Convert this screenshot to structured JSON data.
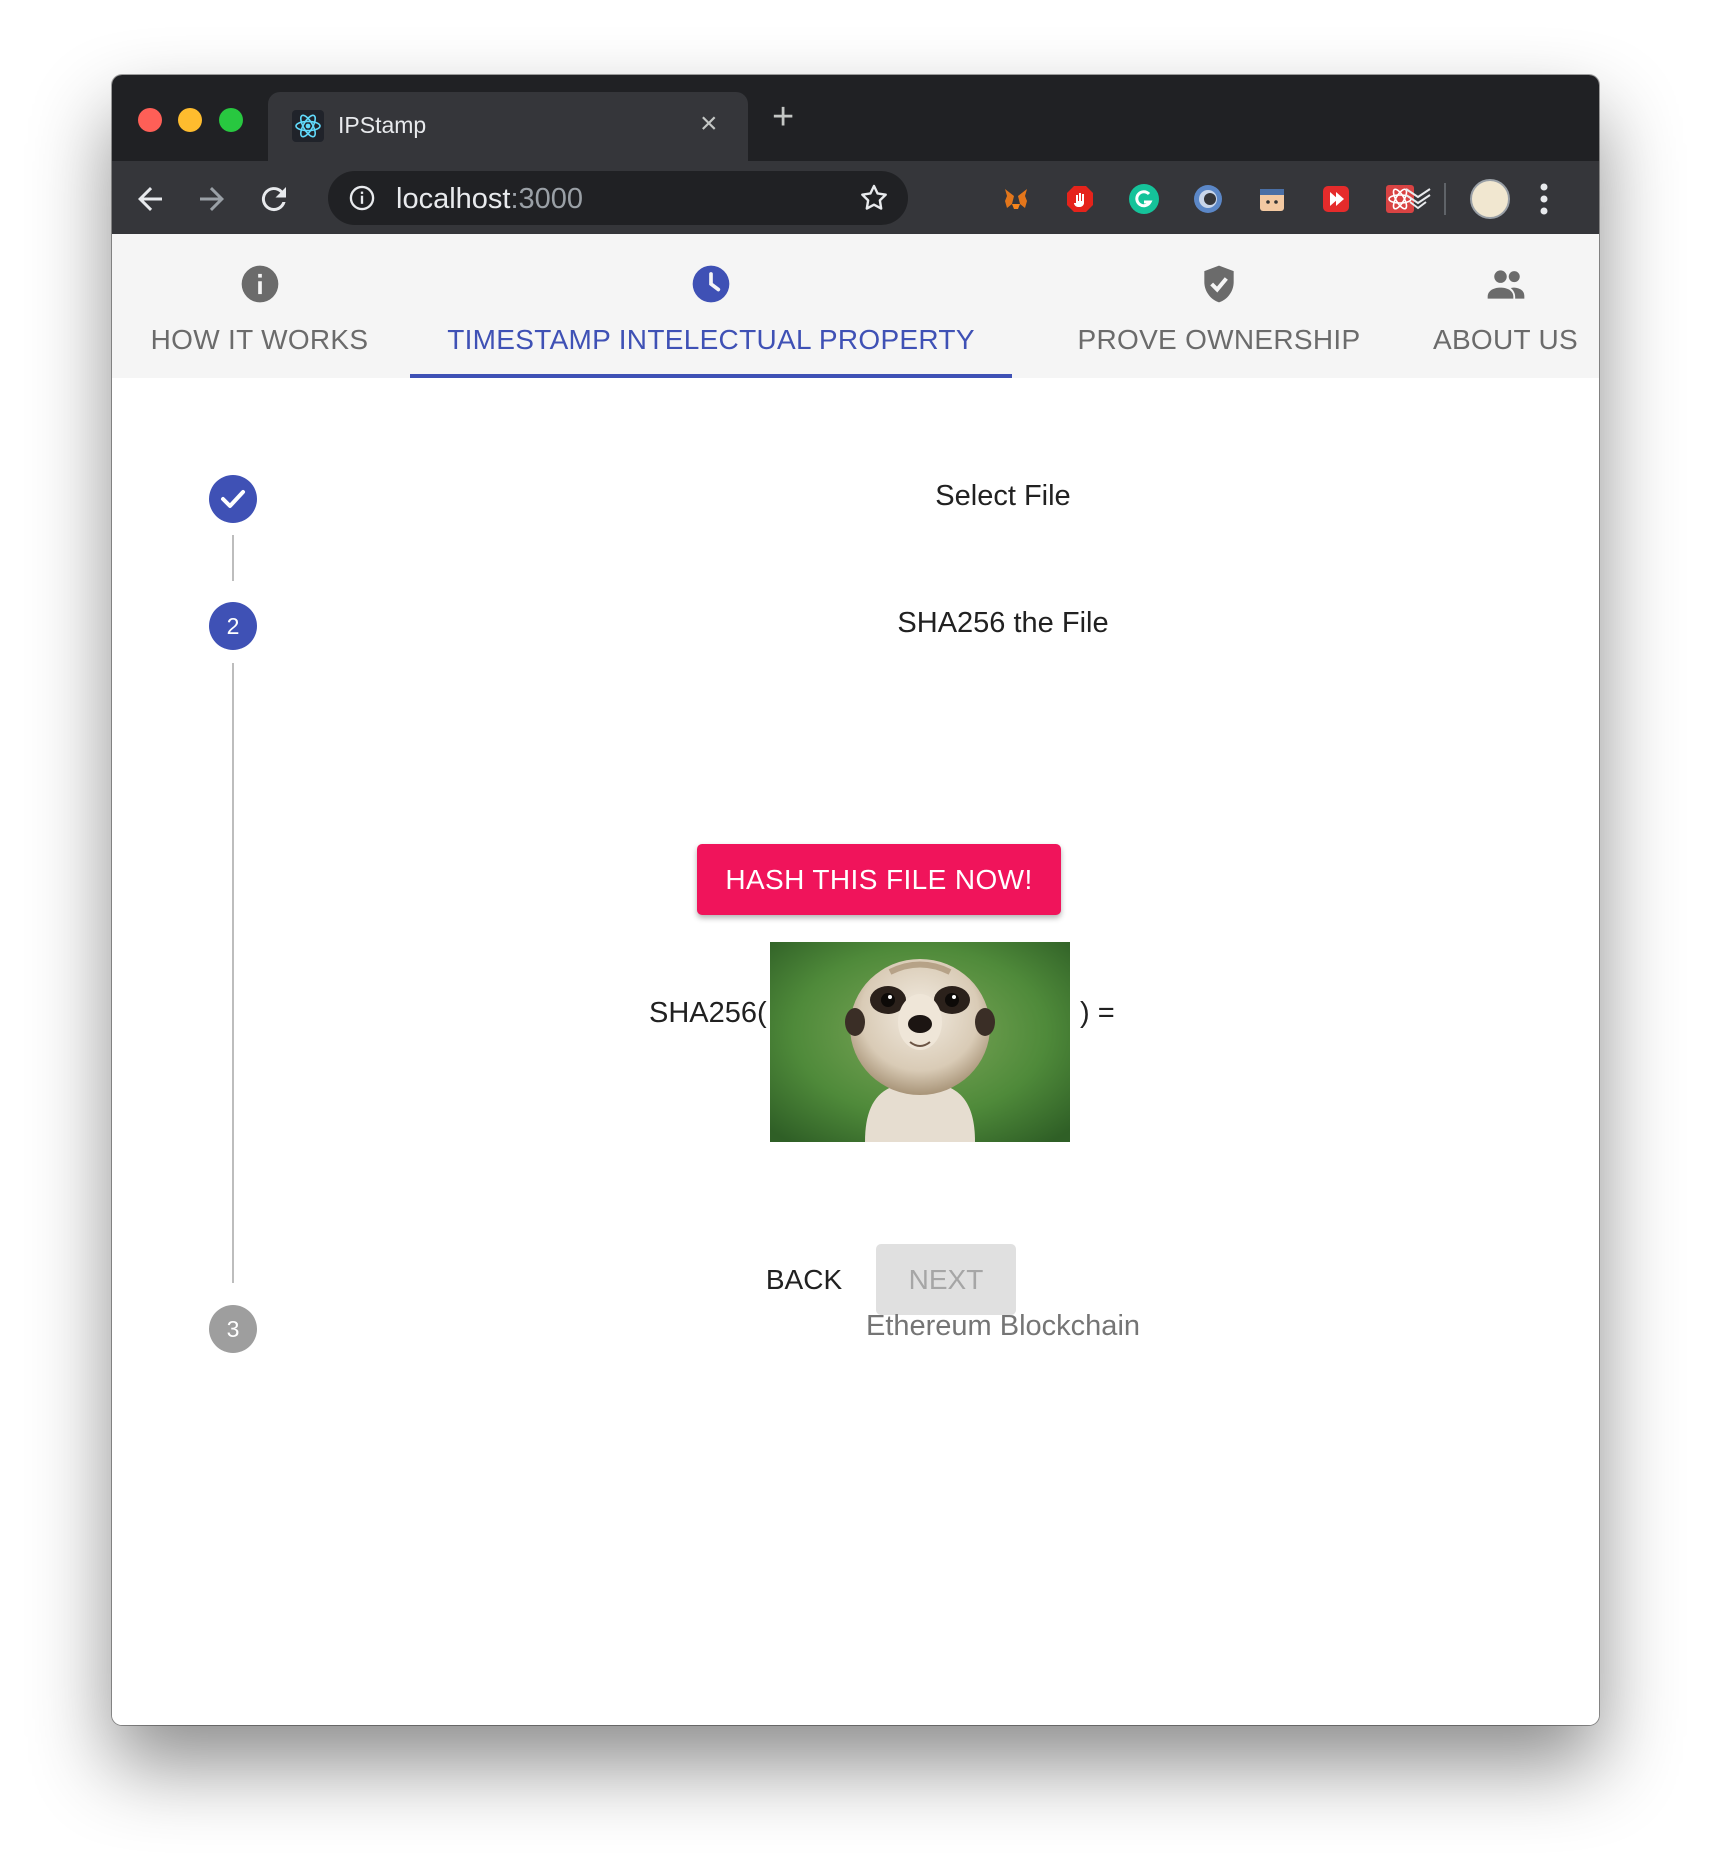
{
  "browser": {
    "tab_title": "IPStamp",
    "url_host": "localhost",
    "url_port": ":3000",
    "new_tab": "+",
    "close_tab": "×"
  },
  "app_nav": {
    "tabs": [
      {
        "label": "HOW IT WORKS",
        "icon": "info-icon",
        "active": false
      },
      {
        "label": "TIMESTAMP INTELECTUAL PROPERTY",
        "icon": "clock-icon",
        "active": true
      },
      {
        "label": "PROVE OWNERSHIP",
        "icon": "verified-shield-icon",
        "active": false
      },
      {
        "label": "ABOUT US",
        "icon": "people-icon",
        "active": false
      }
    ]
  },
  "stepper": {
    "steps": [
      {
        "label": "Select File",
        "state": "completed"
      },
      {
        "number": "2",
        "label": "SHA256 the File",
        "state": "active"
      },
      {
        "number": "3",
        "label": "Ethereum Blockchain",
        "state": "disabled"
      }
    ],
    "hash_button": "HASH THIS FILE NOW!",
    "sha_open": "SHA256(",
    "sha_close": ") =",
    "back_button": "BACK",
    "next_button": "NEXT"
  },
  "colors": {
    "primary": "#3f51b5",
    "accent": "#f0145b",
    "disabled_step": "#9e9e9e"
  }
}
